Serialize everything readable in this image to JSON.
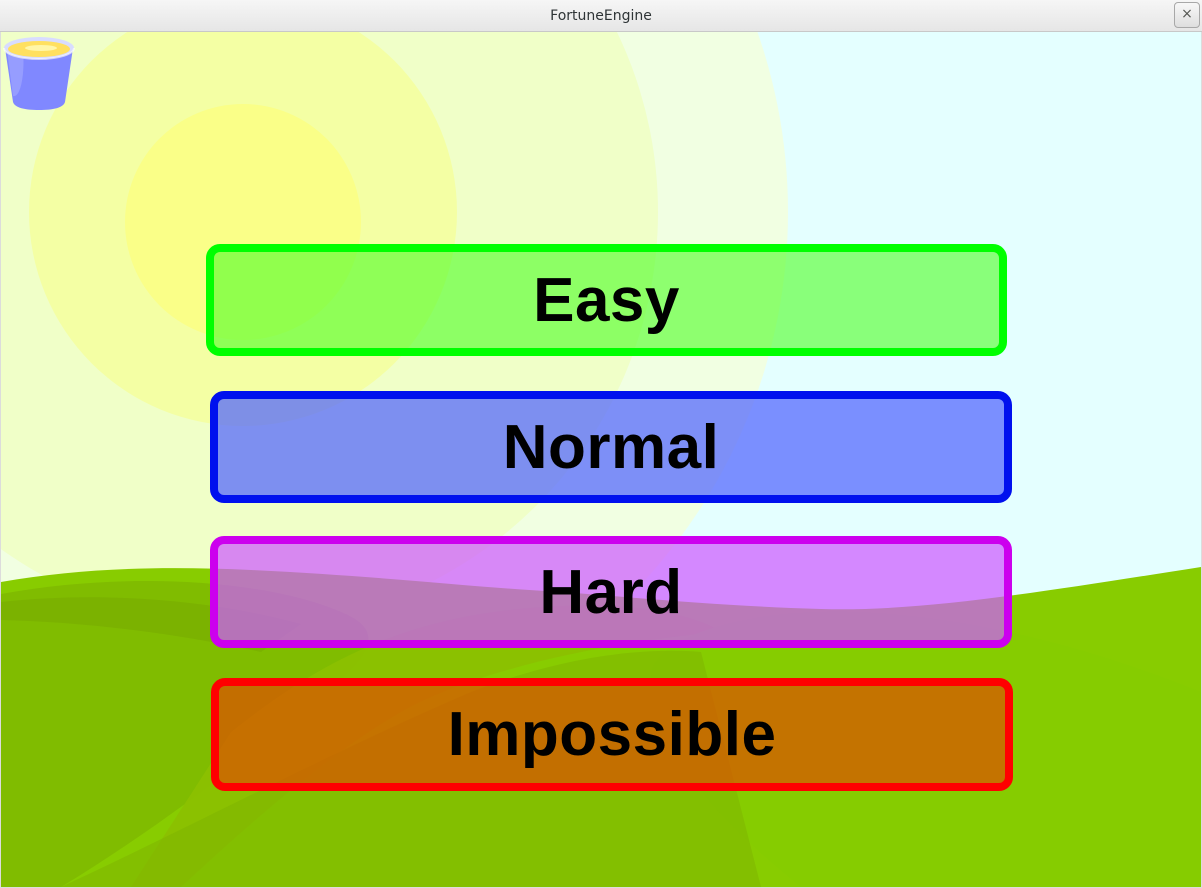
{
  "window": {
    "title": "FortuneEngine",
    "close_label": "×"
  },
  "menu": {
    "buttons": [
      {
        "label": "Easy",
        "border": "#00ff00",
        "fill": "rgba(80,255,40,0.62)"
      },
      {
        "label": "Normal",
        "border": "#0010ee",
        "fill": "rgba(80,100,255,0.72)"
      },
      {
        "label": "Hard",
        "border": "#cc00ee",
        "fill": "rgba(205,90,255,0.72)"
      },
      {
        "label": "Impossible",
        "border": "#ff0000",
        "fill": "rgba(220,80,0,0.72)"
      }
    ]
  },
  "scene": {
    "sky": "#e4ffff",
    "sun": "#ffff80",
    "hills": "#88cc00",
    "cup_icon": "cup-icon"
  }
}
